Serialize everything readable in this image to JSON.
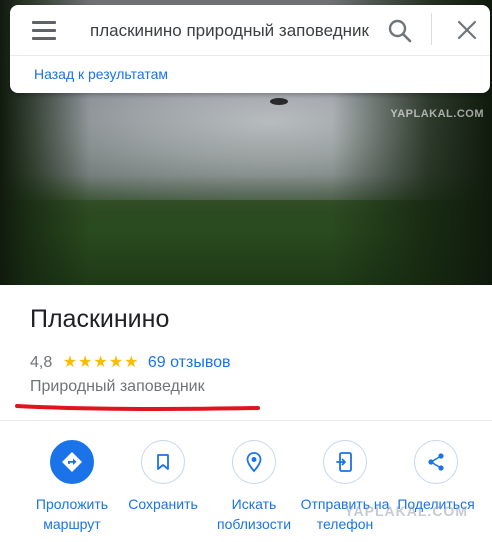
{
  "search": {
    "query": "пласкинино природный заповедник"
  },
  "nav": {
    "back_label": "Назад к результатам"
  },
  "watermark": {
    "top": "YAPLAKAL.COM",
    "bottom": "YAPLAKAL.COM"
  },
  "place": {
    "name": "Пласкинино",
    "rating": "4,8",
    "stars": "★★★★★",
    "reviews": "69 отзывов",
    "category": "Природный заповедник"
  },
  "actions": [
    {
      "label": "Проложить маршрут",
      "icon": "directions-icon"
    },
    {
      "label": "Сохранить",
      "icon": "bookmark-icon"
    },
    {
      "label": "Искать поблизости",
      "icon": "nearby-icon"
    },
    {
      "label": "Отправить на телефон",
      "icon": "send-to-phone-icon"
    },
    {
      "label": "Поделиться",
      "icon": "share-icon"
    }
  ],
  "colors": {
    "accent": "#1a73e8",
    "star": "#fbbc04",
    "annotation": "#e0141e"
  }
}
